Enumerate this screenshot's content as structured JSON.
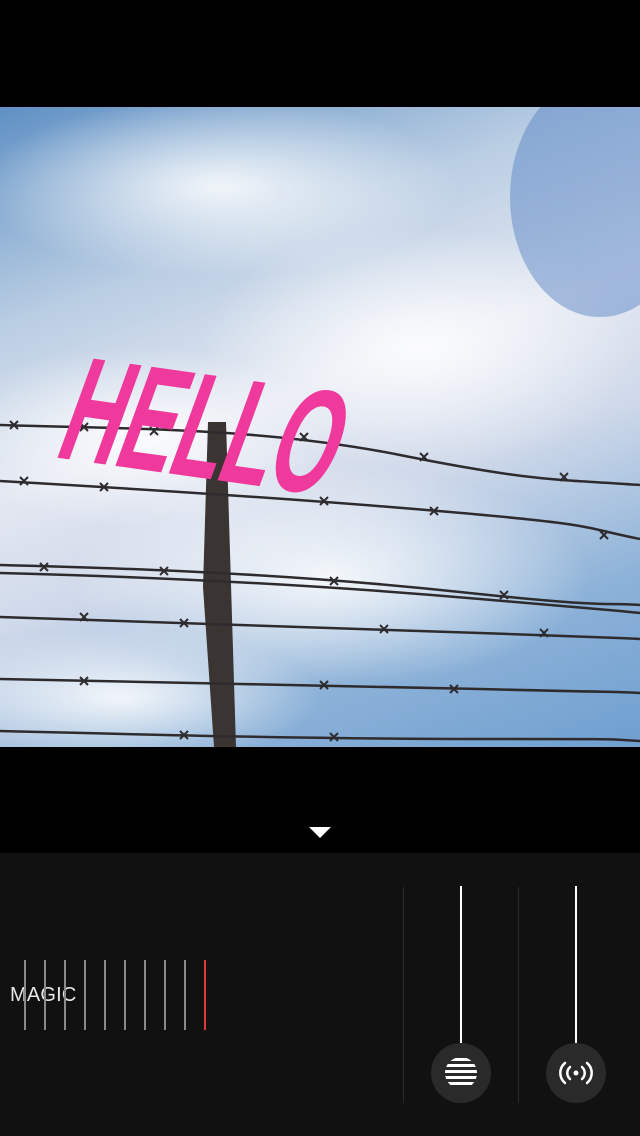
{
  "photo": {
    "overlay_text": "HELLO",
    "overlay_color": "#f0399c",
    "sky_color": "#8db2d8"
  },
  "toolbar": {
    "collapse_icon": "chevron-down-icon"
  },
  "controls": {
    "magic_label": "MAGIC",
    "magic_selected_step": 10,
    "magic_step_count": 10,
    "accent_color": "#e03a3a",
    "slider_one_icon": "horizontal-lines-icon",
    "slider_two_icon": "radio-waves-icon"
  }
}
